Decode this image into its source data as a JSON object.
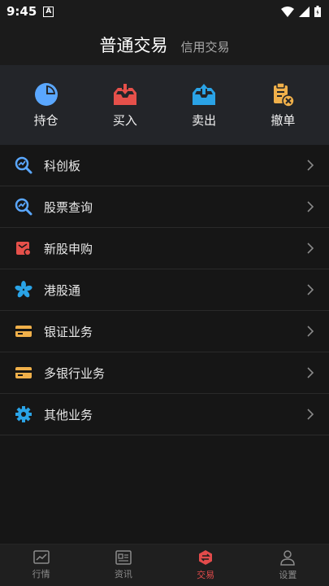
{
  "status_bar": {
    "time": "9:45",
    "notif_badge": "A"
  },
  "header": {
    "tab_active": "普通交易",
    "tab_inactive": "信用交易"
  },
  "quick_actions": [
    {
      "label": "持仓",
      "icon": "pie-chart-icon",
      "color": "#5aa7ff"
    },
    {
      "label": "买入",
      "icon": "inbox-download-icon",
      "color": "#e5504a"
    },
    {
      "label": "卖出",
      "icon": "inbox-upload-icon",
      "color": "#2aa3e6"
    },
    {
      "label": "撤单",
      "icon": "clipboard-cancel-icon",
      "color": "#f0b04a"
    }
  ],
  "menu": [
    {
      "label": "科创板",
      "icon": "magnifier-chart-icon"
    },
    {
      "label": "股票查询",
      "icon": "magnifier-chart-icon"
    },
    {
      "label": "新股申购",
      "icon": "new-stock-icon"
    },
    {
      "label": "港股通",
      "icon": "bauhinia-icon"
    },
    {
      "label": "银证业务",
      "icon": "card-icon"
    },
    {
      "label": "多银行业务",
      "icon": "card-icon"
    },
    {
      "label": "其他业务",
      "icon": "gear-icon"
    }
  ],
  "bottom_nav": [
    {
      "label": "行情",
      "icon": "market-chart-icon",
      "active": false
    },
    {
      "label": "资讯",
      "icon": "news-icon",
      "active": false
    },
    {
      "label": "交易",
      "icon": "trade-icon",
      "active": true
    },
    {
      "label": "设置",
      "icon": "user-icon",
      "active": false
    }
  ],
  "colors": {
    "accent_red": "#e34b4b",
    "accent_blue": "#5aa7ff",
    "accent_orange": "#f0b04a"
  }
}
